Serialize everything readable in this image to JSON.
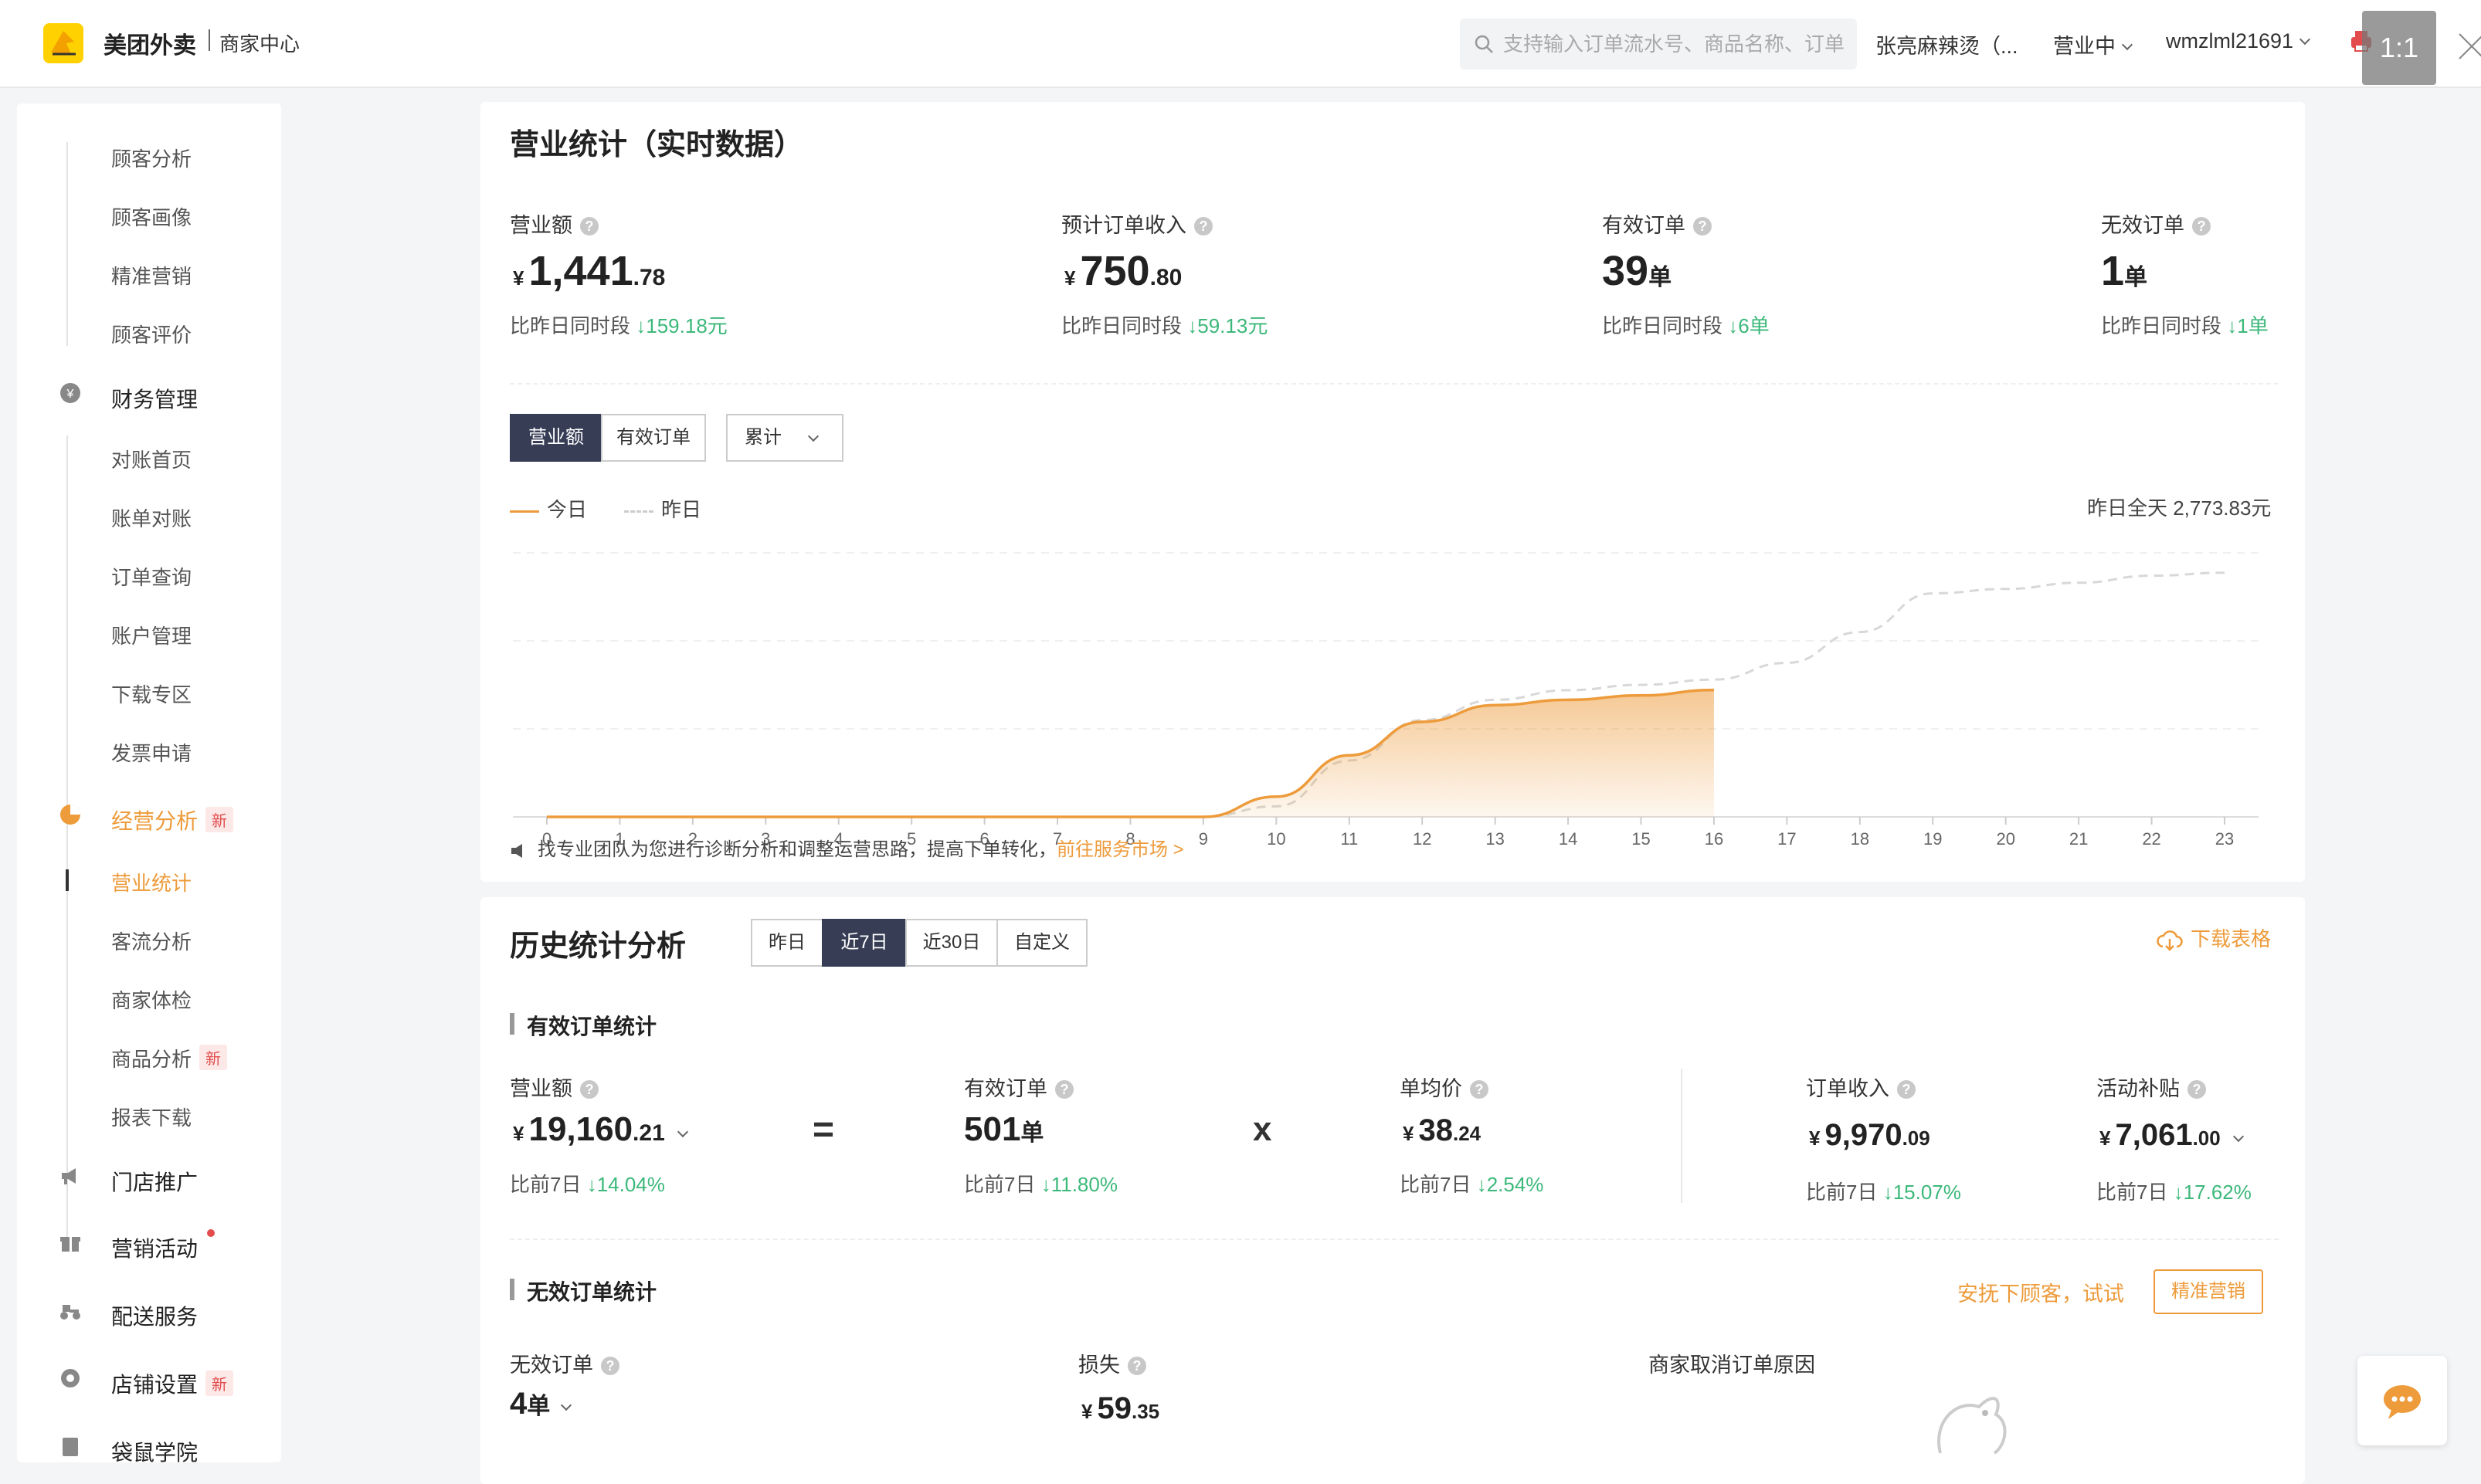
{
  "header": {
    "brand": "美团外卖",
    "brand_sub": "商家中心",
    "search_placeholder": "支持输入订单流水号、商品名称、订单",
    "store": "张亮麻辣烫（...",
    "status": "营业中",
    "user": "wmzlml21691",
    "overlay_label": "1:1"
  },
  "sidebar": {
    "customer_items": [
      "顾客分析",
      "顾客画像",
      "精准营销",
      "顾客评价"
    ],
    "finance_group": "财务管理",
    "finance_items": [
      "对账首页",
      "账单对账",
      "订单查询",
      "账户管理",
      "下载专区",
      "发票申请"
    ],
    "analysis_group": "经营分析",
    "new_badge": "新",
    "analysis_items": [
      "营业统计",
      "客流分析",
      "商家体检",
      "商品分析",
      "报表下载"
    ],
    "promote": "门店推广",
    "marketing": "营销活动",
    "delivery": "配送服务",
    "store_settings": "店铺设置",
    "academy": "袋鼠学院"
  },
  "realtime": {
    "title": "营业统计（实时数据）",
    "compare_prefix": "比昨日同时段",
    "metrics": [
      {
        "label": "营业额",
        "currency": "¥",
        "int": "1,441",
        "dec": ".78",
        "unit": "",
        "change": "↓159.18元"
      },
      {
        "label": "预计订单收入",
        "currency": "¥",
        "int": "750",
        "dec": ".80",
        "unit": "",
        "change": "↓59.13元"
      },
      {
        "label": "有效订单",
        "currency": "",
        "int": "39",
        "dec": "",
        "unit": "单",
        "change": "↓6单"
      },
      {
        "label": "无效订单",
        "currency": "",
        "int": "1",
        "dec": "",
        "unit": "单",
        "change": "↓1单"
      }
    ],
    "tabs": [
      "营业额",
      "有效订单"
    ],
    "mode": "累计",
    "legend_today": "今日",
    "legend_yesterday": "昨日",
    "yesterday_total": "昨日全天 2,773.83元",
    "tip": "找专业团队为您进行诊断分析和调整运营思路，提高下单转化，",
    "tip_link": "前往服务市场 >"
  },
  "chart_data": {
    "type": "area",
    "x": [
      0,
      1,
      2,
      3,
      4,
      5,
      6,
      7,
      8,
      9,
      10,
      11,
      12,
      13,
      14,
      15,
      16,
      17,
      18,
      19,
      20,
      21,
      22,
      23
    ],
    "series": [
      {
        "name": "今日",
        "values": [
          0,
          0,
          0,
          0,
          0,
          0,
          0,
          0,
          0,
          0,
          230,
          700,
          1080,
          1270,
          1330,
          1380,
          1441.78,
          null,
          null,
          null,
          null,
          null,
          null,
          null
        ]
      },
      {
        "name": "昨日",
        "values": [
          0,
          0,
          0,
          0,
          0,
          0,
          0,
          0,
          0,
          0,
          120,
          640,
          1100,
          1330,
          1440,
          1500,
          1560,
          1750,
          2100,
          2540,
          2590,
          2660,
          2740,
          2773.83
        ]
      }
    ],
    "ylim": [
      0,
      3000
    ],
    "grid": true,
    "legend": "top-left"
  },
  "history": {
    "title": "历史统计分析",
    "ranges": [
      "昨日",
      "近7日",
      "近30日",
      "自定义"
    ],
    "download": "下载表格",
    "valid_title": "有效订单统计",
    "compare_prefix": "比前7日",
    "revenue": {
      "label": "营业额",
      "currency": "¥",
      "int": "19,160",
      "dec": ".21",
      "change": "↓14.04%"
    },
    "orders": {
      "label": "有效订单",
      "int": "501",
      "unit": "单",
      "change": "↓11.80%"
    },
    "avg": {
      "label": "单均价",
      "currency": "¥",
      "int": "38",
      "dec": ".24",
      "change": "↓2.54%"
    },
    "income": {
      "label": "订单收入",
      "currency": "¥",
      "int": "9,970",
      "dec": ".09",
      "change": "↓15.07%"
    },
    "subsidy": {
      "label": "活动补贴",
      "currency": "¥",
      "int": "7,061",
      "dec": ".00",
      "change": "↓17.62%"
    },
    "op_eq": "=",
    "op_x": "x",
    "invalid_title": "无效订单统计",
    "soothe": "安抚下顾客，试试",
    "precise_btn": "精准营销",
    "invalid": {
      "label": "无效订单",
      "int": "4",
      "unit": "单"
    },
    "loss": {
      "label": "损失",
      "currency": "¥",
      "int": "59",
      "dec": ".35"
    },
    "cancel_reason": "商家取消订单原因"
  },
  "colors": {
    "accent": "#ed9b3b",
    "dark": "#363d55",
    "down": "#3cb87a"
  }
}
